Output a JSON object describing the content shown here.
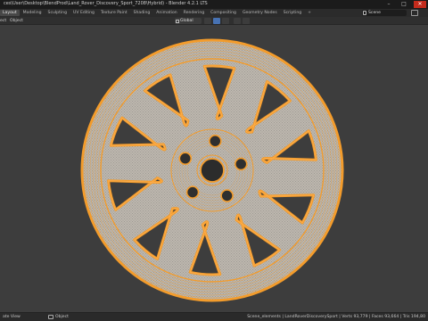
{
  "window": {
    "title": "ces\\User\\Desktop\\BlendProd\\Land_Rover_Discovery_Sport_7208\\Hybrid) - Blender 4.2.1 LTS",
    "minimize": "–",
    "maximize": "□",
    "close": "✕"
  },
  "menubar": {
    "tabs": [
      "Layout",
      "Modeling",
      "Sculpting",
      "UV Editing",
      "Texture Paint",
      "Shading",
      "Animation",
      "Rendering",
      "Compositing",
      "Geometry Nodes",
      "Scripting",
      "+"
    ],
    "active_tab": "Layout",
    "scene": "Scene"
  },
  "header": {
    "mode_label": "ect",
    "object_menu": "Object",
    "orientation": "Global"
  },
  "viewport": {
    "wireframe_color": "#f39c2c",
    "mesh_color": "#c9c3bb",
    "background": "#3d3d3d"
  },
  "statusbar": {
    "left": "ate View",
    "mid": "Object",
    "right": "Scene_elements | LandRoverDiscoverySport | Verts 93,779 | Faces 93,664 | Tris 194,80"
  }
}
